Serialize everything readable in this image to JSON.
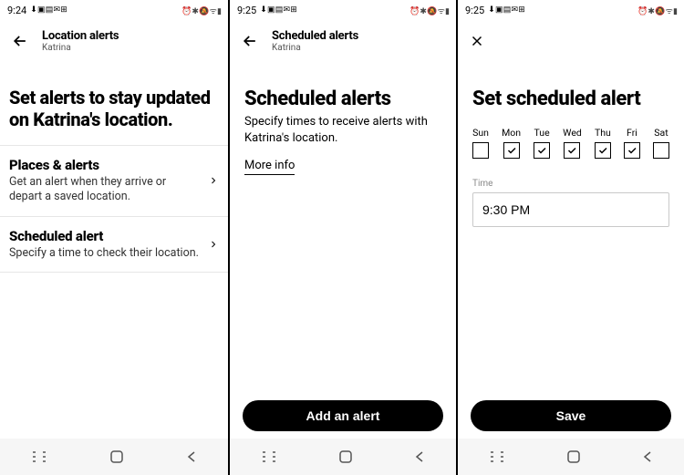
{
  "screens": [
    {
      "status": {
        "time": "9:24",
        "right": ""
      },
      "header": {
        "title": "Location alerts",
        "sub": "Katrina"
      },
      "hero": "Set alerts to stay updated on Katrina's location.",
      "rows": [
        {
          "title": "Places & alerts",
          "sub": "Get an alert when they arrive or depart a saved location."
        },
        {
          "title": "Scheduled alert",
          "sub": "Specify a time to check their location."
        }
      ]
    },
    {
      "status": {
        "time": "9:25"
      },
      "header": {
        "title": "Scheduled alerts",
        "sub": "Katrina"
      },
      "hero": "Scheduled alerts",
      "sub": "Specify times to receive alerts with Katrina's location.",
      "more": "More info",
      "button": "Add an alert"
    },
    {
      "status": {
        "time": "9:25"
      },
      "hero": "Set scheduled alert",
      "days": [
        {
          "label": "Sun",
          "checked": false
        },
        {
          "label": "Mon",
          "checked": true
        },
        {
          "label": "Tue",
          "checked": true
        },
        {
          "label": "Wed",
          "checked": true
        },
        {
          "label": "Thu",
          "checked": true
        },
        {
          "label": "Fri",
          "checked": true
        },
        {
          "label": "Sat",
          "checked": false
        }
      ],
      "time_label": "Time",
      "time_value": "9:30 PM",
      "button": "Save"
    }
  ]
}
